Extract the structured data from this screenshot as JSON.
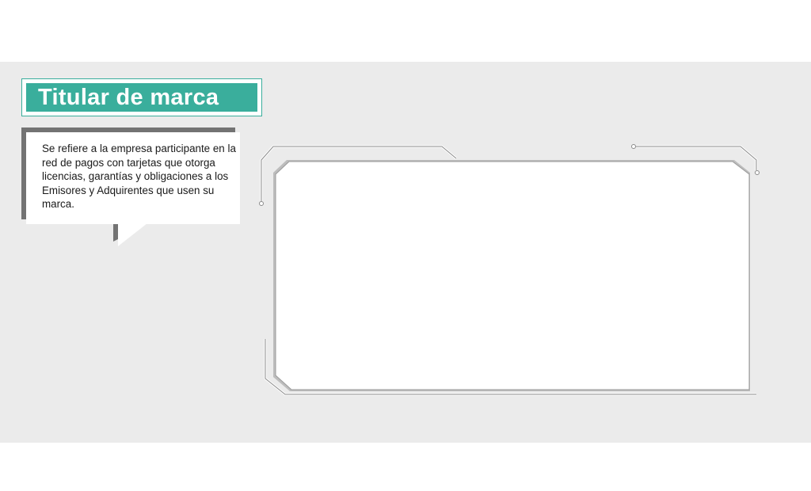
{
  "title": "Titular de marca",
  "description": "Se refiere a la empresa participante en la red de pagos con tarjetas que otorga licencias, garantías y obligaciones a los Emisores y Adquirentes que usen su marca.",
  "colors": {
    "accent": "#3aae9c",
    "band_background": "#ebebeb",
    "shadow": "#737373"
  }
}
